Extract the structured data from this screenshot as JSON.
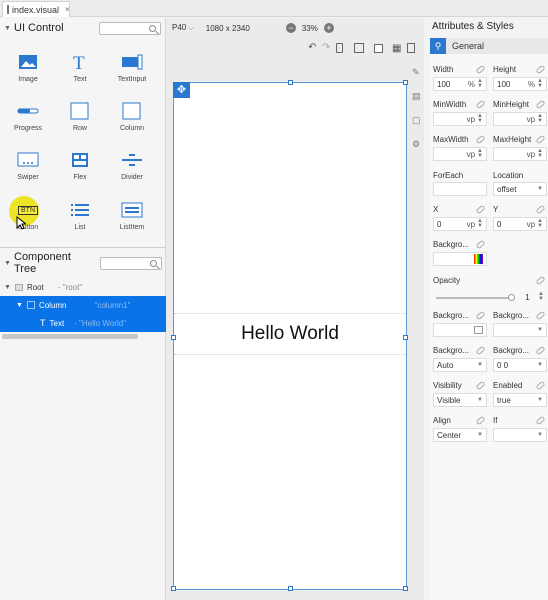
{
  "tab": {
    "filename": "index.visual",
    "close": "×"
  },
  "ui_control": {
    "title": "UI Control",
    "items": [
      {
        "label": "Image"
      },
      {
        "label": "Text"
      },
      {
        "label": "TextInput"
      },
      {
        "label": "Progress"
      },
      {
        "label": "Row"
      },
      {
        "label": "Column"
      },
      {
        "label": "Swiper"
      },
      {
        "label": "Flex"
      },
      {
        "label": "Divider"
      },
      {
        "label": "Button"
      },
      {
        "label": "List"
      },
      {
        "label": "ListItem"
      }
    ],
    "button_icon_text": "BTN"
  },
  "component_tree": {
    "title": "Component Tree",
    "rows": [
      {
        "name": "Root",
        "id": "- \"root\""
      },
      {
        "name": "Column",
        "id": "\"column1\""
      },
      {
        "name": "Text",
        "id": "- \"Hello World\""
      }
    ]
  },
  "toolbar": {
    "device": "P40",
    "resolution": "1080 x 2340",
    "zoom": "33%",
    "zoom_out": "−",
    "zoom_in": "+"
  },
  "canvas": {
    "text": "Hello World"
  },
  "attributes": {
    "title": "Attributes & Styles",
    "group": "General",
    "width": {
      "label": "Width",
      "value": "100",
      "unit": "%"
    },
    "height": {
      "label": "Height",
      "value": "100",
      "unit": "%"
    },
    "min_width": {
      "label": "MinWidth",
      "unit": "vp"
    },
    "min_height": {
      "label": "MinHeight",
      "unit": "vp"
    },
    "max_width": {
      "label": "MaxWidth",
      "unit": "vp"
    },
    "max_height": {
      "label": "MaxHeight",
      "unit": "vp"
    },
    "for_each": {
      "label": "ForEach"
    },
    "location": {
      "label": "Location",
      "value": "offset"
    },
    "x": {
      "label": "X",
      "value": "0",
      "unit": "vp"
    },
    "y": {
      "label": "Y",
      "value": "0",
      "unit": "vp"
    },
    "background_color": {
      "label": "Backgro..."
    },
    "opacity": {
      "label": "Opacity",
      "value": "1"
    },
    "background_image": {
      "label": "Backgro..."
    },
    "background_image_2": {
      "label": "Backgro..."
    },
    "background_size": {
      "label": "Backgro...",
      "value": "Auto"
    },
    "background_position": {
      "label": "Backgro...",
      "value": "0 0"
    },
    "visibility": {
      "label": "Visibility",
      "value": "Visible"
    },
    "enabled": {
      "label": "Enabled",
      "value": "true"
    },
    "align": {
      "label": "Align",
      "value": "Center"
    },
    "if": {
      "label": "If"
    }
  },
  "colors": {
    "accent": "#0a73e8",
    "selection_border": "#2a78d0"
  }
}
